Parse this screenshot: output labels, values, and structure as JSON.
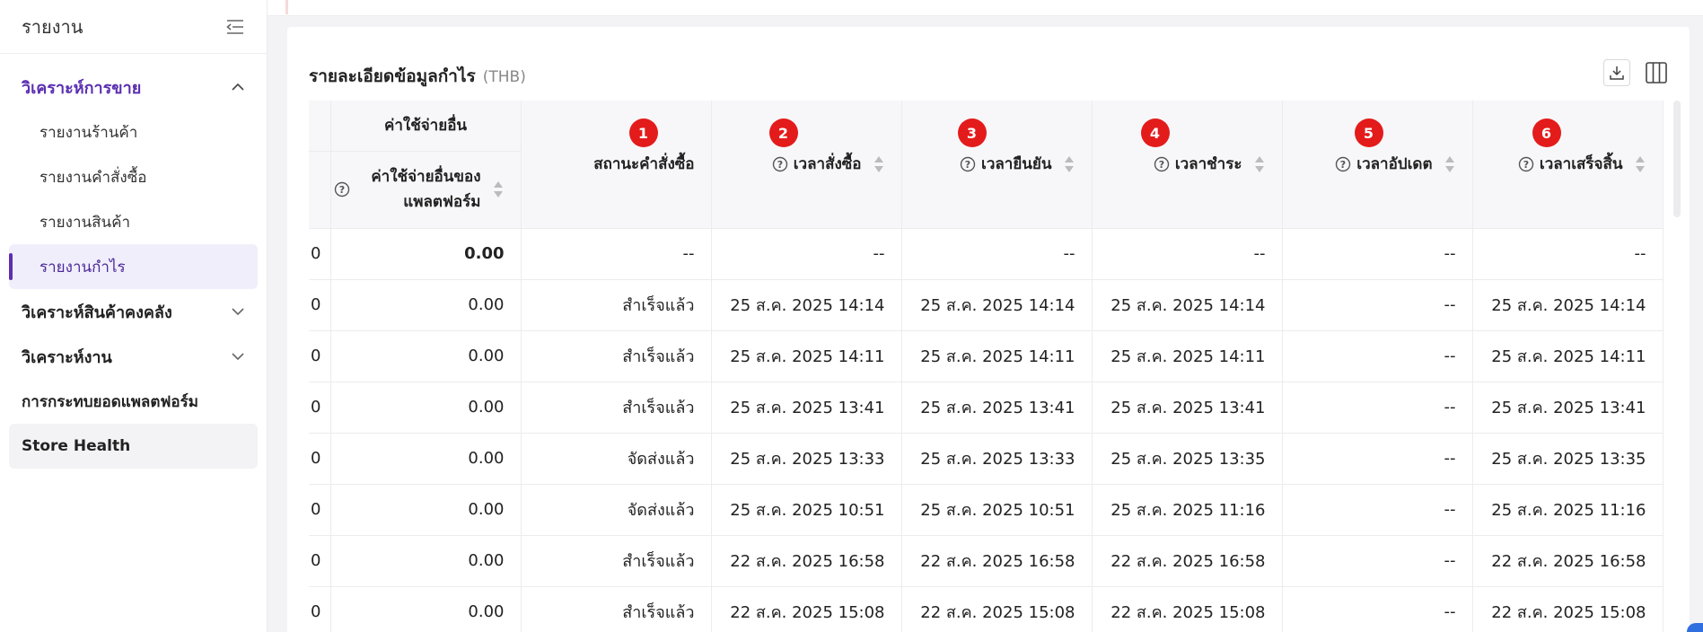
{
  "sidebar": {
    "title": "รายงาน",
    "groups": [
      {
        "label": "วิเคราะห์การขาย",
        "expanded": true,
        "items": [
          "รายงานร้านค้า",
          "รายงานคำสั่งซื้อ",
          "รายงานสินค้า",
          "รายงานกำไร"
        ]
      },
      {
        "label": "วิเคราะห์สินค้าคงคลัง",
        "expanded": false
      },
      {
        "label": "วิเคราะห์งาน",
        "expanded": false
      }
    ],
    "plain_items": [
      "การกระทบยอดแพลตฟอร์ม",
      "Store Health"
    ],
    "selected": "รายงานกำไร"
  },
  "card": {
    "title": "รายละเอียดข้อมูลกำไร",
    "unit": "(THB)"
  },
  "table": {
    "group_header": "ค่าใช้จ่ายอื่น",
    "sub_header": "ค่าใช้จ่ายอื่นของแพลตฟอร์ม",
    "columns": [
      {
        "label": "สถานะคำสั่งซื้อ",
        "badge": "1"
      },
      {
        "label": "เวลาสั่งซื้อ",
        "badge": "2"
      },
      {
        "label": "เวลายืนยัน",
        "badge": "3"
      },
      {
        "label": "เวลาชำระ",
        "badge": "4"
      },
      {
        "label": "เวลาอัปเดต",
        "badge": "5"
      },
      {
        "label": "เวลาเสร็จสิ้น",
        "badge": "6"
      }
    ],
    "cut_value": "0",
    "rows": [
      {
        "fee": "0.00",
        "status": "--",
        "order": "--",
        "confirm": "--",
        "pay": "--",
        "update": "--",
        "finish": "--"
      },
      {
        "fee": "0.00",
        "status": "สำเร็จแล้ว",
        "order": "25 ส.ค. 2025 14:14",
        "confirm": "25 ส.ค. 2025 14:14",
        "pay": "25 ส.ค. 2025 14:14",
        "update": "--",
        "finish": "25 ส.ค. 2025 14:14"
      },
      {
        "fee": "0.00",
        "status": "สำเร็จแล้ว",
        "order": "25 ส.ค. 2025 14:11",
        "confirm": "25 ส.ค. 2025 14:11",
        "pay": "25 ส.ค. 2025 14:11",
        "update": "--",
        "finish": "25 ส.ค. 2025 14:11"
      },
      {
        "fee": "0.00",
        "status": "สำเร็จแล้ว",
        "order": "25 ส.ค. 2025 13:41",
        "confirm": "25 ส.ค. 2025 13:41",
        "pay": "25 ส.ค. 2025 13:41",
        "update": "--",
        "finish": "25 ส.ค. 2025 13:41"
      },
      {
        "fee": "0.00",
        "status": "จัดส่งแล้ว",
        "order": "25 ส.ค. 2025 13:33",
        "confirm": "25 ส.ค. 2025 13:33",
        "pay": "25 ส.ค. 2025 13:35",
        "update": "--",
        "finish": "25 ส.ค. 2025 13:35"
      },
      {
        "fee": "0.00",
        "status": "จัดส่งแล้ว",
        "order": "25 ส.ค. 2025 10:51",
        "confirm": "25 ส.ค. 2025 10:51",
        "pay": "25 ส.ค. 2025 11:16",
        "update": "--",
        "finish": "25 ส.ค. 2025 11:16"
      },
      {
        "fee": "0.00",
        "status": "สำเร็จแล้ว",
        "order": "22 ส.ค. 2025 16:58",
        "confirm": "22 ส.ค. 2025 16:58",
        "pay": "22 ส.ค. 2025 16:58",
        "update": "--",
        "finish": "22 ส.ค. 2025 16:58"
      },
      {
        "fee": "0.00",
        "status": "สำเร็จแล้ว",
        "order": "22 ส.ค. 2025 15:08",
        "confirm": "22 ส.ค. 2025 15:08",
        "pay": "22 ส.ค. 2025 15:08",
        "update": "--",
        "finish": "22 ส.ค. 2025 15:08"
      }
    ]
  },
  "icons": {
    "collapse": "collapse-sidebar-icon",
    "download": "download-icon",
    "columns": "columns-icon",
    "help": "help-circle-icon",
    "sort": "sort-icon"
  },
  "colors": {
    "accent": "#5b2fb1",
    "badge": "#e41b1b"
  }
}
